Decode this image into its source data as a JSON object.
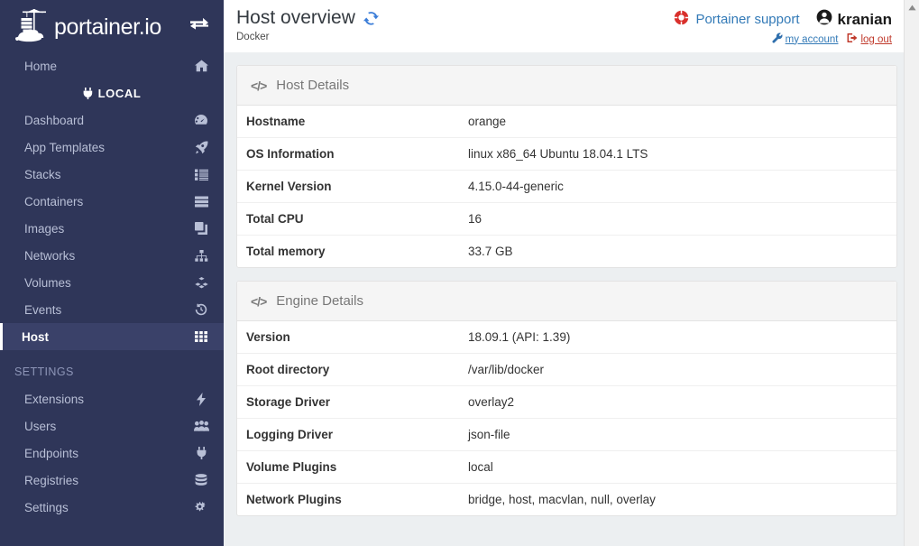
{
  "sidebar": {
    "brand": "portainer.io",
    "brand_logo_icon": "portainer-whale-logo",
    "toggle_icon": "exchange-arrows-icon",
    "home": {
      "label": "Home",
      "icon": "home-icon"
    },
    "endpoint": {
      "label": "LOCAL",
      "icon": "plug-icon"
    },
    "items": [
      {
        "label": "Dashboard",
        "icon": "tachometer-icon",
        "active": false
      },
      {
        "label": "App Templates",
        "icon": "rocket-icon",
        "active": false
      },
      {
        "label": "Stacks",
        "icon": "list-icon",
        "active": false
      },
      {
        "label": "Containers",
        "icon": "server-icon",
        "active": false
      },
      {
        "label": "Images",
        "icon": "clone-icon",
        "active": false
      },
      {
        "label": "Networks",
        "icon": "sitemap-icon",
        "active": false
      },
      {
        "label": "Volumes",
        "icon": "cubes-icon",
        "active": false
      },
      {
        "label": "Events",
        "icon": "history-icon",
        "active": false
      },
      {
        "label": "Host",
        "icon": "th-icon",
        "active": true
      }
    ],
    "settings_title": "SETTINGS",
    "settings_items": [
      {
        "label": "Extensions",
        "icon": "bolt-icon"
      },
      {
        "label": "Users",
        "icon": "users-icon"
      },
      {
        "label": "Endpoints",
        "icon": "plug-icon"
      },
      {
        "label": "Registries",
        "icon": "database-icon"
      },
      {
        "label": "Settings",
        "icon": "cogs-icon"
      }
    ]
  },
  "header": {
    "title": "Host overview",
    "refresh_icon": "sync-refresh-icon",
    "subtitle": "Docker",
    "support_label": "Portainer support",
    "support_icon": "lifebuoy-icon",
    "username": "kranian",
    "user_icon": "user-circle-icon",
    "my_account_label": "my account",
    "my_account_icon": "wrench-icon",
    "logout_label": "log out",
    "logout_icon": "sign-out-icon"
  },
  "panels": [
    {
      "title": "Host Details",
      "icon": "code-icon",
      "rows": [
        {
          "key": "Hostname",
          "value": "orange"
        },
        {
          "key": "OS Information",
          "value": "linux x86_64 Ubuntu 18.04.1 LTS"
        },
        {
          "key": "Kernel Version",
          "value": "4.15.0-44-generic"
        },
        {
          "key": "Total CPU",
          "value": "16"
        },
        {
          "key": "Total memory",
          "value": "33.7 GB"
        }
      ]
    },
    {
      "title": "Engine Details",
      "icon": "code-icon",
      "rows": [
        {
          "key": "Version",
          "value": "18.09.1 (API: 1.39)"
        },
        {
          "key": "Root directory",
          "value": "/var/lib/docker"
        },
        {
          "key": "Storage Driver",
          "value": "overlay2"
        },
        {
          "key": "Logging Driver",
          "value": "json-file"
        },
        {
          "key": "Volume Plugins",
          "value": "local"
        },
        {
          "key": "Network Plugins",
          "value": "bridge, host, macvlan, null, overlay"
        }
      ]
    }
  ],
  "scrollbar": {
    "up_arrow_icon": "scroll-up-arrow-icon"
  },
  "colors": {
    "sidebar_bg": "#2f3659",
    "sidebar_active_bg": "#3a4169",
    "content_bg": "#eceff1",
    "panel_bg": "#ffffff",
    "panel_header_bg": "#f5f5f5",
    "link_blue": "#337ab7",
    "danger_red": "#c0392b",
    "support_red": "#d9302c"
  }
}
